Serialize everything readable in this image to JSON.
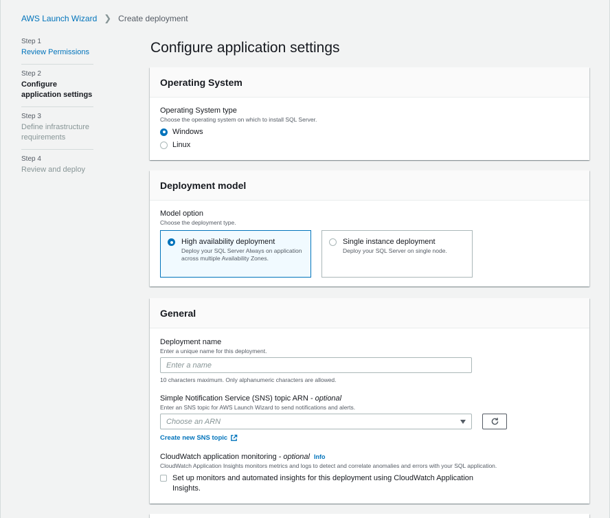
{
  "breadcrumb": {
    "root": "AWS Launch Wizard",
    "current": "Create deployment"
  },
  "steps": [
    {
      "num": "Step 1",
      "label": "Review Permissions"
    },
    {
      "num": "Step 2",
      "label": "Configure application settings"
    },
    {
      "num": "Step 3",
      "label": "Define infrastructure requirements"
    },
    {
      "num": "Step 4",
      "label": "Review and deploy"
    }
  ],
  "page_title": "Configure application settings",
  "os_panel": {
    "title": "Operating System",
    "label": "Operating System type",
    "desc": "Choose the operating system on which to install SQL Server.",
    "options": [
      "Windows",
      "Linux"
    ],
    "selected": "Windows"
  },
  "deploy_panel": {
    "title": "Deployment model",
    "label": "Model option",
    "desc": "Choose the deployment type.",
    "tiles": [
      {
        "title": "High availability deployment",
        "desc": "Deploy your SQL Server Always on application across multiple Availability Zones."
      },
      {
        "title": "Single instance deployment",
        "desc": "Deploy your SQL Server on single node."
      }
    ],
    "selected": "High availability deployment"
  },
  "general_panel": {
    "title": "General",
    "name_label": "Deployment name",
    "name_desc": "Enter a unique name for this deployment.",
    "name_placeholder": "Enter a name",
    "name_constraint": "10 characters maximum. Only alphanumeric characters are allowed.",
    "sns_label": "Simple Notification Service (SNS) topic ARN",
    "sns_optional": "- optional",
    "sns_desc": "Enter an SNS topic for AWS Launch Wizard to send notifications and alerts.",
    "sns_placeholder": "Choose an ARN",
    "sns_link": "Create new SNS topic",
    "cw_label": "CloudWatch application monitoring",
    "cw_optional": "- optional",
    "cw_info": "Info",
    "cw_desc": "CloudWatch Application Insights monitors metrics and logs to detect and correlate anomalies and errors with your SQL application.",
    "cw_checkbox": "Set up monitors and automated insights for this deployment using CloudWatch Application Insights."
  },
  "colors": {
    "accent": "#0073bb",
    "background": "#f2f3f3"
  }
}
